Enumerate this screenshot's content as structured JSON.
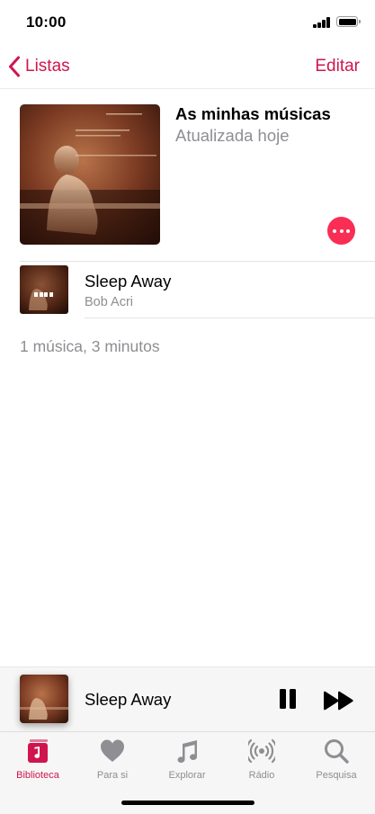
{
  "status_bar": {
    "time": "10:00"
  },
  "nav": {
    "back_label": "Listas",
    "edit_label": "Editar"
  },
  "playlist": {
    "title": "As minhas músicas",
    "subtitle": "Atualizada hoje",
    "more_icon": "ellipsis-icon"
  },
  "songs": [
    {
      "title": "Sleep Away",
      "artist": "Bob Acri"
    }
  ],
  "summary": "1 música, 3 minutos",
  "mini_player": {
    "title": "Sleep Away"
  },
  "tabs": [
    {
      "label": "Biblioteca",
      "icon": "library-icon",
      "active": true
    },
    {
      "label": "Para si",
      "icon": "heart-icon",
      "active": false
    },
    {
      "label": "Explorar",
      "icon": "music-note-icon",
      "active": false
    },
    {
      "label": "Rádio",
      "icon": "radio-icon",
      "active": false
    },
    {
      "label": "Pesquisa",
      "icon": "search-icon",
      "active": false
    }
  ],
  "colors": {
    "accent": "#d0154e",
    "more_button": "#fa2d55",
    "secondary_text": "#8e8e93"
  }
}
